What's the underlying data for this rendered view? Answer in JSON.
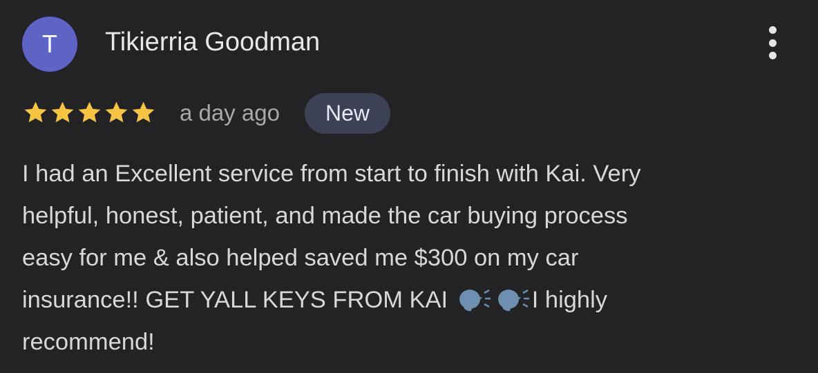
{
  "review": {
    "avatar_letter": "T",
    "reviewer_name": "Tikierria Goodman",
    "rating": 5,
    "rating_max": 5,
    "timestamp": "a day ago",
    "badge": "New",
    "text_lines": [
      "I had an Excellent service from start to finish with Kai. Very",
      "helpful, honest, patient, and made the car buying process",
      "easy for me & also helped saved me $300 on my car",
      "insurance!! GET YALL KEYS FROM KAI ",
      "I highly",
      "recommend!"
    ],
    "emojis": [
      "speaking-head-emoji",
      "speaking-head-emoji"
    ]
  },
  "colors": {
    "background": "#232326",
    "avatar": "#5e63c6",
    "star": "#f6c444",
    "badge_bg": "#3c4155",
    "emoji": "#6f8fb0"
  },
  "icons": {
    "more": "more-vert-icon",
    "star": "star-icon"
  }
}
